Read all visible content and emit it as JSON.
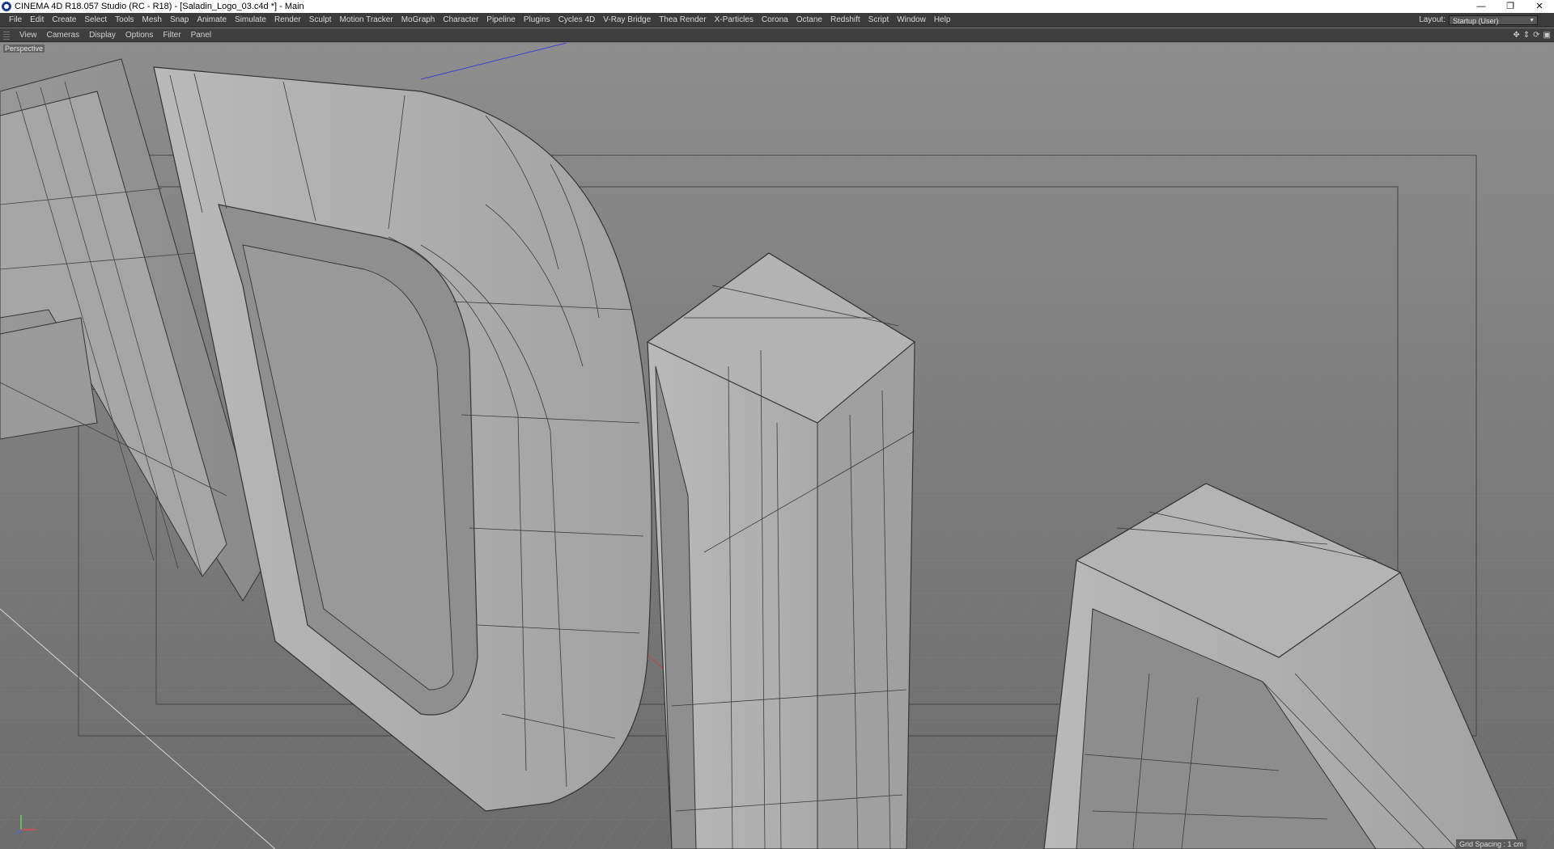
{
  "window": {
    "title": "CINEMA 4D R18.057 Studio (RC - R18) - [Saladin_Logo_03.c4d *] - Main",
    "controls": {
      "minimize": "—",
      "restore": "❐",
      "close": "✕"
    }
  },
  "menu": [
    "File",
    "Edit",
    "Create",
    "Select",
    "Tools",
    "Mesh",
    "Snap",
    "Animate",
    "Simulate",
    "Render",
    "Sculpt",
    "Motion Tracker",
    "MoGraph",
    "Character",
    "Pipeline",
    "Plugins",
    "Cycles 4D",
    "V-Ray Bridge",
    "Thea Render",
    "X-Particles",
    "Corona",
    "Octane",
    "Redshift",
    "Script",
    "Window",
    "Help"
  ],
  "layout": {
    "label": "Layout:",
    "value": "Startup (User)"
  },
  "viewport_menu": [
    "View",
    "Cameras",
    "Display",
    "Options",
    "Filter",
    "Panel"
  ],
  "viewport": {
    "camera_label": "Perspective",
    "grid_spacing": "Grid Spacing : 1 cm",
    "background_color": "#7a7a7a"
  },
  "icons": {
    "app": "cinema4d-logo-icon",
    "nav": [
      "move-view-icon",
      "zoom-view-icon",
      "rotate-view-icon",
      "maximize-view-icon"
    ]
  }
}
